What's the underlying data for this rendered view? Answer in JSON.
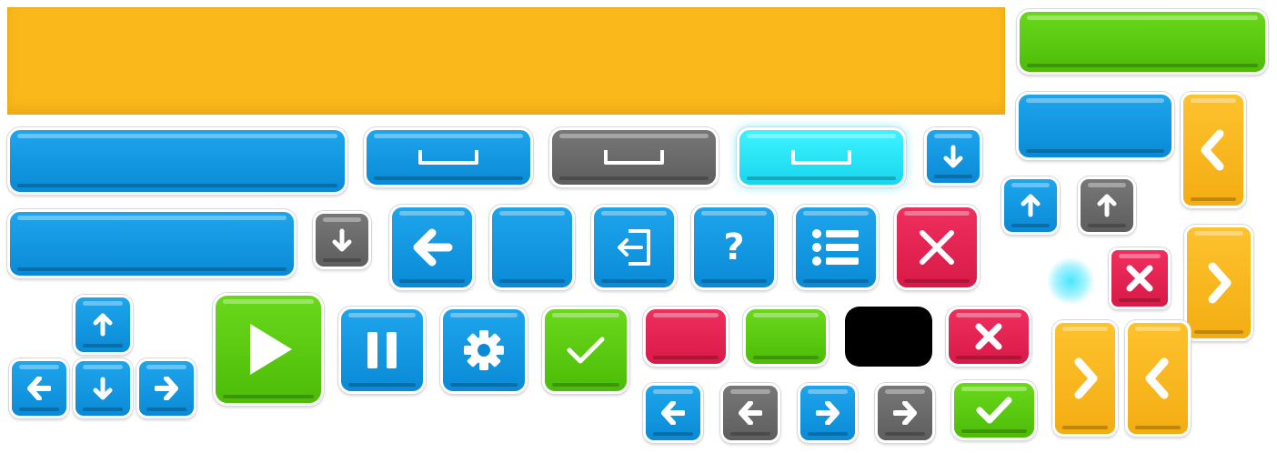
{
  "sheet": {
    "colors": {
      "blue": "#0a8ad6",
      "gray": "#5e5e5e",
      "cyan": "#18d6ef",
      "green": "#4cbc08",
      "red": "#d81a48",
      "yellow": "#f4ad12",
      "banner": "#fbb81b",
      "black": "#000000"
    },
    "icons": [
      "space-key-icon",
      "arrow-down-icon",
      "arrow-up-icon",
      "arrow-left-icon",
      "arrow-right-icon",
      "exit-door-icon",
      "help-question-icon",
      "list-menu-icon",
      "close-x-icon",
      "play-icon",
      "pause-icon",
      "gear-icon",
      "checkmark-icon",
      "chevron-left-icon",
      "chevron-right-icon"
    ],
    "help_glyph": "?"
  }
}
